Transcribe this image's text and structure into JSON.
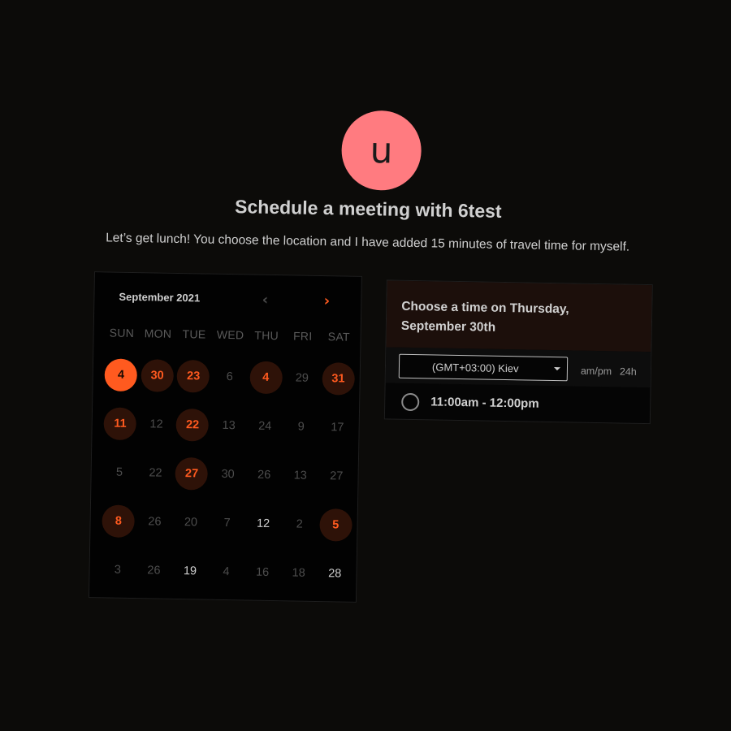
{
  "avatar_letter": "u",
  "title": "Schedule a meeting with 6test",
  "subtitle": "Let’s get lunch! You choose the location and I have added 15 minutes of travel time for myself.",
  "calendar": {
    "month_label": "September 2021",
    "prev_icon": "chevron-left-icon",
    "next_icon": "chevron-right-icon",
    "weekdays": [
      "SUN",
      "MON",
      "TUE",
      "WED",
      "THU",
      "FRI",
      "SAT"
    ],
    "days": [
      {
        "label": "4",
        "state": "selected"
      },
      {
        "label": "30",
        "state": "available"
      },
      {
        "label": "23",
        "state": "available"
      },
      {
        "label": "6",
        "state": "muted"
      },
      {
        "label": "4",
        "state": "available"
      },
      {
        "label": "29",
        "state": "muted"
      },
      {
        "label": "31",
        "state": "available"
      },
      {
        "label": "11",
        "state": "available"
      },
      {
        "label": "12",
        "state": "muted"
      },
      {
        "label": "22",
        "state": "available"
      },
      {
        "label": "13",
        "state": "muted"
      },
      {
        "label": "24",
        "state": "muted"
      },
      {
        "label": "9",
        "state": "muted"
      },
      {
        "label": "17",
        "state": "muted"
      },
      {
        "label": "5",
        "state": "muted"
      },
      {
        "label": "22",
        "state": "muted"
      },
      {
        "label": "27",
        "state": "available"
      },
      {
        "label": "30",
        "state": "muted"
      },
      {
        "label": "26",
        "state": "muted"
      },
      {
        "label": "13",
        "state": "muted"
      },
      {
        "label": "27",
        "state": "muted"
      },
      {
        "label": "8",
        "state": "available"
      },
      {
        "label": "26",
        "state": "muted"
      },
      {
        "label": "20",
        "state": "muted"
      },
      {
        "label": "7",
        "state": "muted"
      },
      {
        "label": "12",
        "state": "light"
      },
      {
        "label": "2",
        "state": "muted"
      },
      {
        "label": "5",
        "state": "available"
      },
      {
        "label": "3",
        "state": "muted"
      },
      {
        "label": "26",
        "state": "muted"
      },
      {
        "label": "19",
        "state": "light"
      },
      {
        "label": "4",
        "state": "muted"
      },
      {
        "label": "16",
        "state": "muted"
      },
      {
        "label": "18",
        "state": "muted"
      },
      {
        "label": "28",
        "state": "light"
      }
    ],
    "colors": {
      "accent": "#ff5a1f",
      "available_bg": "#2e1208",
      "muted_text": "#4d4d4d"
    }
  },
  "time_panel": {
    "heading": "Choose a time on Thursday, September 30th",
    "timezone_value": "(GMT+03:00) Kiev",
    "format_ampm": "am/pm",
    "format_24h": "24h",
    "slots": [
      {
        "label": "11:00am - 12:00pm",
        "selected": false
      }
    ]
  }
}
